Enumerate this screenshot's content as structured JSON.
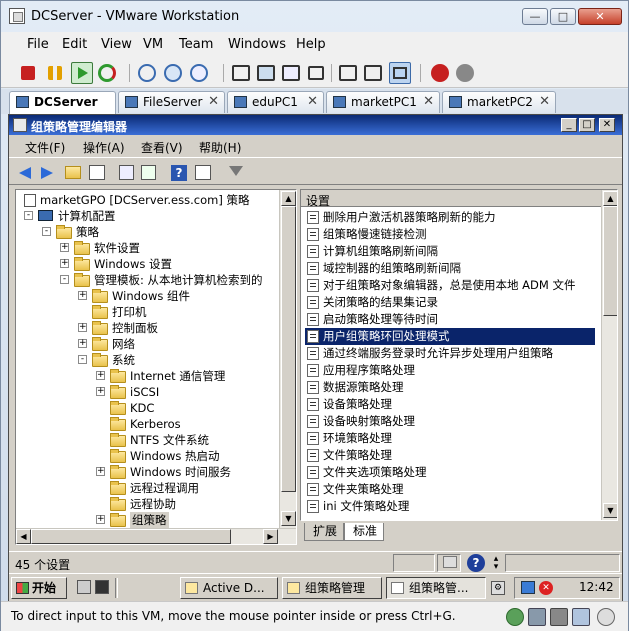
{
  "vmware": {
    "title": "DCServer - VMware Workstation",
    "menu": [
      "File",
      "Edit",
      "View",
      "VM",
      "Team",
      "Windows",
      "Help"
    ],
    "tabs": [
      {
        "label": "DCServer",
        "active": true
      },
      {
        "label": "FileServer",
        "active": false
      },
      {
        "label": "eduPC1",
        "active": false
      },
      {
        "label": "marketPC1",
        "active": false
      },
      {
        "label": "marketPC2",
        "active": false
      }
    ],
    "status_message": "To direct input to this VM, move the mouse pointer inside or press Ctrl+G."
  },
  "gpm": {
    "title": "组策略管理编辑器",
    "menu": [
      "文件(F)",
      "操作(A)",
      "查看(V)",
      "帮助(H)"
    ],
    "tree": [
      {
        "label": "marketGPO [DCServer.ess.com] 策略",
        "level": 0,
        "toggle": "",
        "icon": "doc"
      },
      {
        "label": "计算机配置",
        "level": 0,
        "toggle": "-",
        "icon": "computer"
      },
      {
        "label": "策略",
        "level": 1,
        "toggle": "-",
        "icon": "folder"
      },
      {
        "label": "软件设置",
        "level": 2,
        "toggle": "+",
        "icon": "folder"
      },
      {
        "label": "Windows 设置",
        "level": 2,
        "toggle": "+",
        "icon": "folder"
      },
      {
        "label": "管理模板: 从本地计算机检索到的",
        "level": 2,
        "toggle": "-",
        "icon": "folder"
      },
      {
        "label": "Windows 组件",
        "level": 3,
        "toggle": "+",
        "icon": "folder"
      },
      {
        "label": "打印机",
        "level": 3,
        "toggle": "",
        "icon": "folder"
      },
      {
        "label": "控制面板",
        "level": 3,
        "toggle": "+",
        "icon": "folder"
      },
      {
        "label": "网络",
        "level": 3,
        "toggle": "+",
        "icon": "folder"
      },
      {
        "label": "系统",
        "level": 3,
        "toggle": "-",
        "icon": "folder"
      },
      {
        "label": "Internet 通信管理",
        "level": 4,
        "toggle": "+",
        "icon": "folder"
      },
      {
        "label": "iSCSI",
        "level": 4,
        "toggle": "+",
        "icon": "folder"
      },
      {
        "label": "KDC",
        "level": 4,
        "toggle": "",
        "icon": "folder"
      },
      {
        "label": "Kerberos",
        "level": 4,
        "toggle": "",
        "icon": "folder"
      },
      {
        "label": "NTFS 文件系统",
        "level": 4,
        "toggle": "",
        "icon": "folder"
      },
      {
        "label": "Windows 热启动",
        "level": 4,
        "toggle": "",
        "icon": "folder"
      },
      {
        "label": "Windows 时间服务",
        "level": 4,
        "toggle": "+",
        "icon": "folder"
      },
      {
        "label": "远程过程调用",
        "level": 4,
        "toggle": "",
        "icon": "folder"
      },
      {
        "label": "远程协助",
        "level": 4,
        "toggle": "",
        "icon": "folder"
      },
      {
        "label": "组策略",
        "level": 4,
        "toggle": "+",
        "icon": "folder",
        "selected": true
      }
    ],
    "list_header": "设置",
    "settings": [
      "删除用户激活机器策略刷新的能力",
      "组策略慢速链接检测",
      "计算机组策略刷新间隔",
      "域控制器的组策略刷新间隔",
      "对于组策略对象编辑器，总是使用本地 ADM 文件",
      "关闭策略的结果集记录",
      "启动策略处理等待时间",
      "用户组策略环回处理模式",
      "通过终端服务登录时允许异步处理用户组策略",
      "应用程序策略处理",
      "数据源策略处理",
      "设备策略处理",
      "设备映射策略处理",
      "环境策略处理",
      "文件策略处理",
      "文件夹选项策略处理",
      "文件夹策略处理",
      "ini 文件策略处理"
    ],
    "selected_setting_index": 7,
    "bottom_tabs": [
      "扩展",
      "标准"
    ],
    "status_text": "45 个设置"
  },
  "taskbar": {
    "start_label": "开始",
    "tasks": [
      {
        "label": "Active D...",
        "pressed": false
      },
      {
        "label": "组策略管理",
        "pressed": false
      },
      {
        "label": "组策略管...",
        "pressed": true
      }
    ],
    "clock": "12:42"
  }
}
